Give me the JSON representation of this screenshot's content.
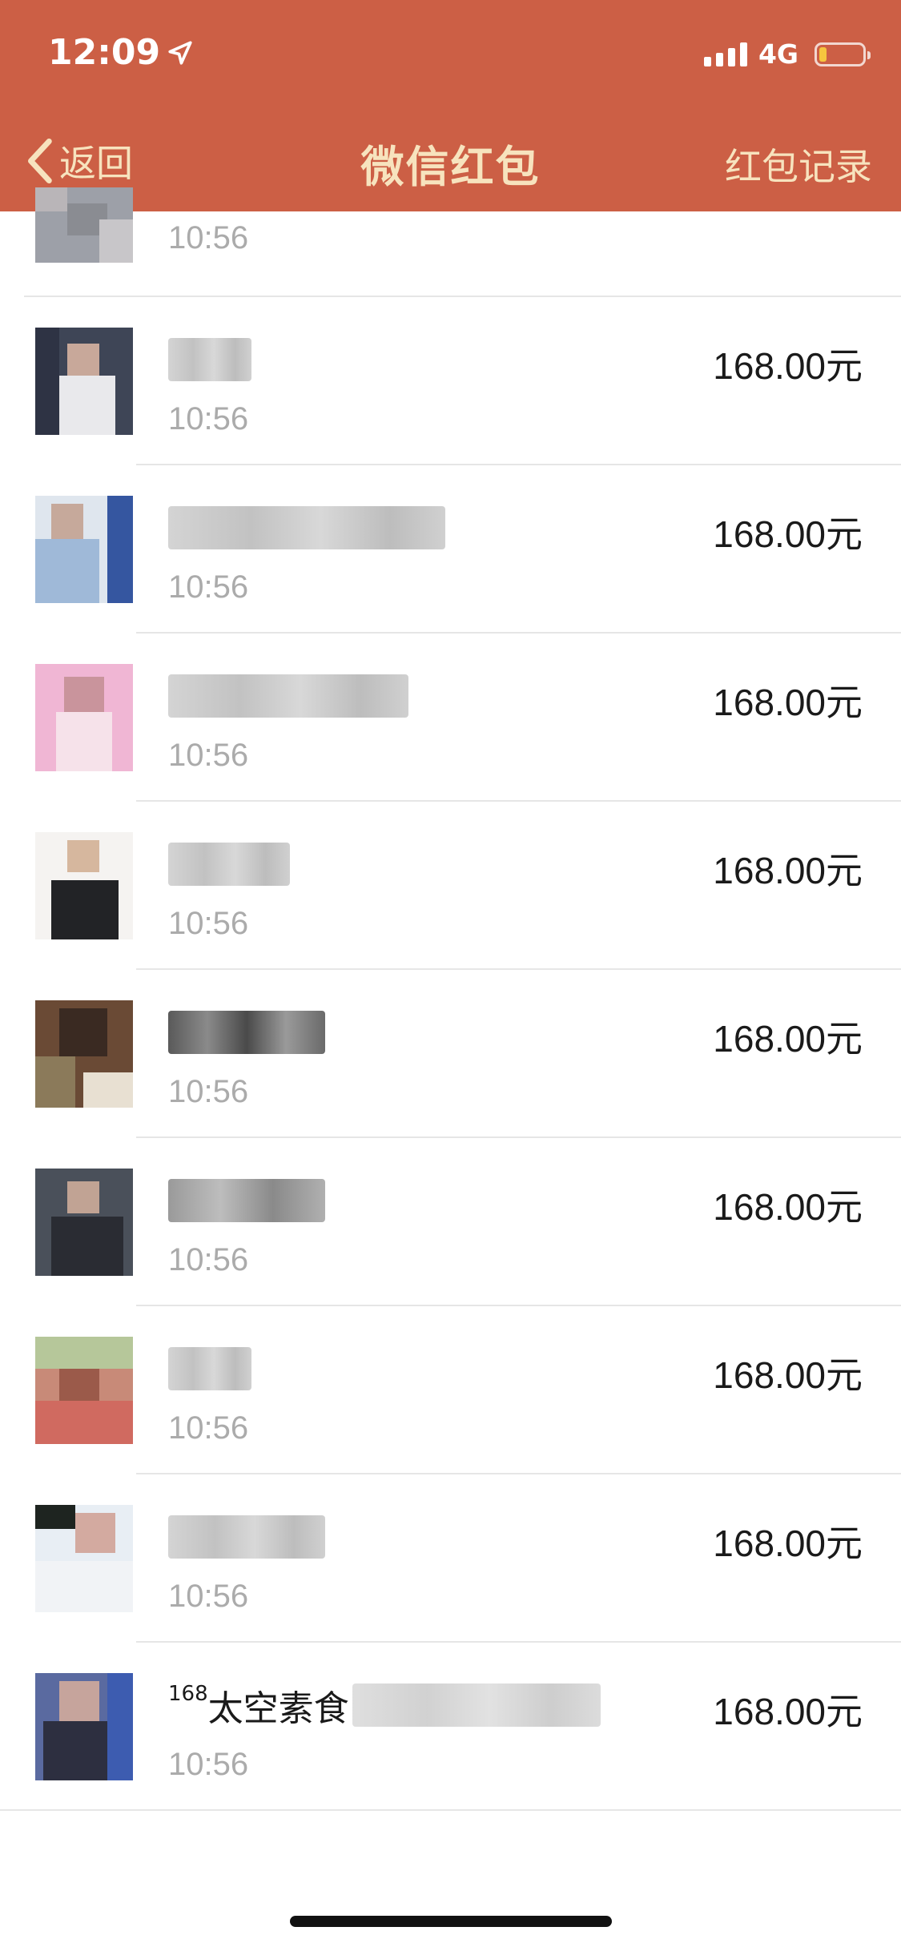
{
  "status_bar": {
    "time": "12:09",
    "network": "4G"
  },
  "nav": {
    "back_label": "返回",
    "title": "微信红包",
    "right_label": "红包记录"
  },
  "colors": {
    "header": "#CC5F45",
    "header_text": "#F7E3BE",
    "battery": "#F6C53E"
  },
  "partial_row": {
    "time": "10:56"
  },
  "rows": [
    {
      "name": "",
      "time": "10:56",
      "amount": "168.00元"
    },
    {
      "name": "",
      "time": "10:56",
      "amount": "168.00元"
    },
    {
      "name": "",
      "time": "10:56",
      "amount": "168.00元"
    },
    {
      "name": "",
      "time": "10:56",
      "amount": "168.00元"
    },
    {
      "name": "",
      "time": "10:56",
      "amount": "168.00元"
    },
    {
      "name": "",
      "time": "10:56",
      "amount": "168.00元"
    },
    {
      "name": "",
      "time": "10:56",
      "amount": "168.00元"
    },
    {
      "name": "",
      "time": "10:56",
      "amount": "168.00元"
    },
    {
      "name_sup": "168",
      "name": "太空素食",
      "time": "10:56",
      "amount": "168.00元"
    }
  ]
}
